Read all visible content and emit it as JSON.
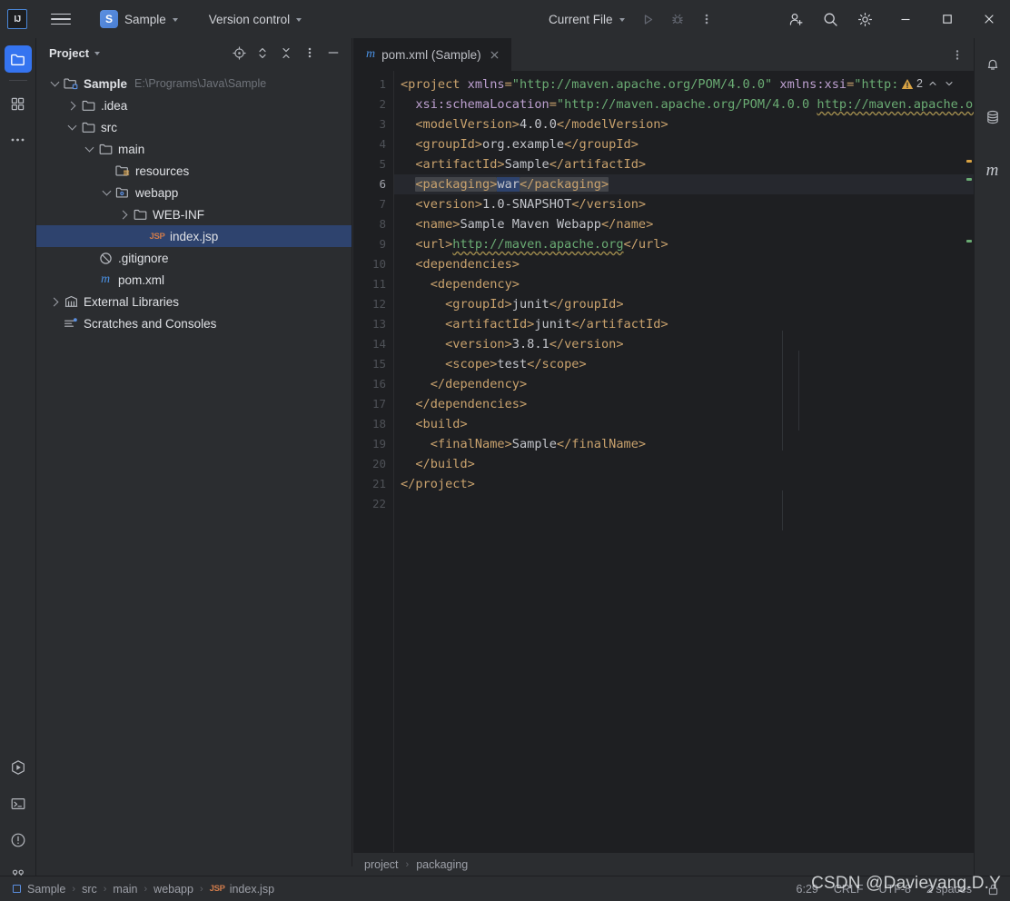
{
  "titlebar": {
    "logo": "IJ",
    "logo_icon": "intellij-logo-icon",
    "menu_icon": "hamburger-menu-icon",
    "project_badge": "S",
    "project_name": "Sample",
    "vcs_label": "Version control",
    "run_config": "Current File",
    "run_icon": "run-icon",
    "debug_icon": "debug-icon",
    "more_icon": "more-vertical-icon",
    "account_icon": "add-user-icon",
    "search_icon": "search-icon",
    "settings_icon": "gear-icon",
    "minimize_icon": "minimize-icon",
    "maximize_icon": "maximize-icon",
    "close_icon": "close-icon"
  },
  "left_rail": {
    "top": [
      {
        "name": "project-icon",
        "label": "Project",
        "active": true
      },
      {
        "name": "structure-icon",
        "label": "Structure",
        "active": false
      },
      {
        "name": "more-tools-icon",
        "label": "More tool windows",
        "active": false
      }
    ],
    "bottom": [
      {
        "name": "run-tool-icon",
        "label": "Run",
        "active": false
      },
      {
        "name": "terminal-icon",
        "label": "Terminal",
        "active": false
      },
      {
        "name": "problems-icon",
        "label": "Problems",
        "active": false
      },
      {
        "name": "git-branch-icon",
        "label": "Version Control",
        "active": false
      }
    ]
  },
  "right_rail": [
    {
      "name": "notifications-bell-icon",
      "label": "Notifications"
    },
    {
      "name": "database-icon",
      "label": "Database"
    },
    {
      "name": "maven-icon",
      "label": "Maven",
      "glyph": "m"
    }
  ],
  "project_panel": {
    "title": "Project",
    "tools": [
      {
        "name": "select-opened-file-icon",
        "label": "Select Opened File"
      },
      {
        "name": "expand-collapse-icon",
        "label": "Expand or Collapse"
      },
      {
        "name": "collapse-all-icon",
        "label": "Collapse All"
      },
      {
        "name": "panel-options-icon",
        "label": "Options"
      },
      {
        "name": "hide-panel-icon",
        "label": "Hide"
      }
    ],
    "tree": [
      {
        "label": "Sample",
        "path": "E:\\Programs\\Java\\Sample",
        "depth": 0,
        "arrow": "down",
        "icon": "module-icon",
        "bold": true,
        "selected": false
      },
      {
        "label": ".idea",
        "path": "",
        "depth": 1,
        "arrow": "right",
        "icon": "folder-icon",
        "bold": false,
        "selected": false
      },
      {
        "label": "src",
        "path": "",
        "depth": 1,
        "arrow": "down",
        "icon": "folder-icon",
        "bold": false,
        "selected": false
      },
      {
        "label": "main",
        "path": "",
        "depth": 2,
        "arrow": "down",
        "icon": "folder-icon",
        "bold": false,
        "selected": false
      },
      {
        "label": "resources",
        "path": "",
        "depth": 3,
        "arrow": "none",
        "icon": "resources-folder-icon",
        "bold": false,
        "selected": false
      },
      {
        "label": "webapp",
        "path": "",
        "depth": 3,
        "arrow": "down",
        "icon": "webapp-folder-icon",
        "bold": false,
        "selected": false
      },
      {
        "label": "WEB-INF",
        "path": "",
        "depth": 4,
        "arrow": "right",
        "icon": "folder-icon",
        "bold": false,
        "selected": false
      },
      {
        "label": "index.jsp",
        "path": "",
        "depth": 5,
        "arrow": "none",
        "icon": "jsp-file-icon",
        "bold": false,
        "selected": true
      },
      {
        "label": ".gitignore",
        "path": "",
        "depth": 2,
        "arrow": "none",
        "icon": "gitignore-icon",
        "bold": false,
        "selected": false
      },
      {
        "label": "pom.xml",
        "path": "",
        "depth": 2,
        "arrow": "none",
        "icon": "maven-file-icon",
        "bold": false,
        "selected": false
      },
      {
        "label": "External Libraries",
        "path": "",
        "depth": 0,
        "arrow": "right",
        "icon": "libraries-icon",
        "bold": false,
        "selected": false
      },
      {
        "label": "Scratches and Consoles",
        "path": "",
        "depth": 0,
        "arrow": "none",
        "icon": "scratches-icon",
        "bold": false,
        "selected": false
      }
    ]
  },
  "editor": {
    "tab": {
      "label": "pom.xml (Sample)",
      "icon": "maven-file-icon",
      "close_icon": "close-icon"
    },
    "tab_options_icon": "more-vertical-icon",
    "inspection": {
      "icon": "warning-triangle-icon",
      "count": "2",
      "prev_icon": "chevron-up-icon",
      "next_icon": "chevron-down-icon"
    },
    "current_line": 6,
    "total_lines": 22,
    "lines": [
      {
        "n": 1,
        "html": "<span class=\"t\">&lt;project</span> <span class=\"at\">xmlns</span><span class=\"t\">=</span><span class=\"st\">\"http://maven.apache.org/POM/4.0.0\"</span> <span class=\"at\">xmlns:xsi</span><span class=\"t\">=</span><span class=\"st\">\"http:/</span>"
      },
      {
        "n": 2,
        "html": "  <span class=\"at\">xsi:schemaLocation</span><span class=\"t\">=</span><span class=\"st\">\"http://maven.apache.org/POM/4.0.0 </span><span class=\"st squig\">http://maven.apache.or</span>"
      },
      {
        "n": 3,
        "html": "  <span class=\"t\">&lt;modelVersion&gt;</span><span class=\"vl\">4.0.0</span><span class=\"t\">&lt;/modelVersion&gt;</span>"
      },
      {
        "n": 4,
        "html": "  <span class=\"t\">&lt;groupId&gt;</span><span class=\"vl\">org.example</span><span class=\"t\">&lt;/groupId&gt;</span>"
      },
      {
        "n": 5,
        "html": "  <span class=\"t\">&lt;artifactId&gt;</span><span class=\"vl\">Sample</span><span class=\"t\">&lt;/artifactId&gt;</span>"
      },
      {
        "n": 6,
        "html": "  <span class=\"t sel\">&lt;packaging&gt;</span><span class=\"vl sel2\">war</span><span class=\"t sel\">&lt;/packaging&gt;</span>"
      },
      {
        "n": 7,
        "html": "  <span class=\"t\">&lt;version&gt;</span><span class=\"vl\">1.0-SNAPSHOT</span><span class=\"t\">&lt;/version&gt;</span>"
      },
      {
        "n": 8,
        "html": "  <span class=\"t\">&lt;name&gt;</span><span class=\"vl\">Sample Maven Webapp</span><span class=\"t\">&lt;/name&gt;</span>"
      },
      {
        "n": 9,
        "html": "  <span class=\"t\">&lt;url&gt;</span><span class=\"lnk squig\">http://maven.apache.org</span><span class=\"t\">&lt;/url&gt;</span>"
      },
      {
        "n": 10,
        "html": "  <span class=\"t\">&lt;dependencies&gt;</span>"
      },
      {
        "n": 11,
        "html": "    <span class=\"t\">&lt;dependency&gt;</span>"
      },
      {
        "n": 12,
        "html": "      <span class=\"t\">&lt;groupId&gt;</span><span class=\"vl\">junit</span><span class=\"t\">&lt;/groupId&gt;</span>"
      },
      {
        "n": 13,
        "html": "      <span class=\"t\">&lt;artifactId&gt;</span><span class=\"vl\">junit</span><span class=\"t\">&lt;/artifactId&gt;</span>"
      },
      {
        "n": 14,
        "html": "      <span class=\"t\">&lt;version&gt;</span><span class=\"vl\">3.8.1</span><span class=\"t\">&lt;/version&gt;</span>"
      },
      {
        "n": 15,
        "html": "      <span class=\"t\">&lt;scope&gt;</span><span class=\"vl\">test</span><span class=\"t\">&lt;/scope&gt;</span>"
      },
      {
        "n": 16,
        "html": "    <span class=\"t\">&lt;/dependency&gt;</span>"
      },
      {
        "n": 17,
        "html": "  <span class=\"t\">&lt;/dependencies&gt;</span>"
      },
      {
        "n": 18,
        "html": "  <span class=\"t\">&lt;build&gt;</span>"
      },
      {
        "n": 19,
        "html": "    <span class=\"t\">&lt;finalName&gt;</span><span class=\"vl\">Sample</span><span class=\"t\">&lt;/finalName&gt;</span>"
      },
      {
        "n": 20,
        "html": "  <span class=\"t\">&lt;/build&gt;</span>"
      },
      {
        "n": 21,
        "html": "<span class=\"t\">&lt;/project&gt;</span>"
      },
      {
        "n": 22,
        "html": ""
      }
    ]
  },
  "breadcrumb_editor": {
    "items": [
      "project",
      "packaging"
    ]
  },
  "statusbar": {
    "crumbs": [
      "Sample",
      "src",
      "main",
      "webapp",
      "index.jsp"
    ],
    "crumb_icon": "jsp-file-icon",
    "caret": "6:29",
    "line_separator": "CRLF",
    "encoding": "UTF-8",
    "indent": "2 spaces",
    "lock_icon": "lock-icon"
  },
  "watermark": "CSDN @Davieyang.D.Y",
  "colors": {
    "accent": "#3574f0",
    "selection": "#2e436e",
    "editor_bg": "#1e1f22",
    "panel_bg": "#2b2d30",
    "tag": "#c9a26d",
    "string": "#6aab73",
    "attribute": "#bda0d0"
  }
}
